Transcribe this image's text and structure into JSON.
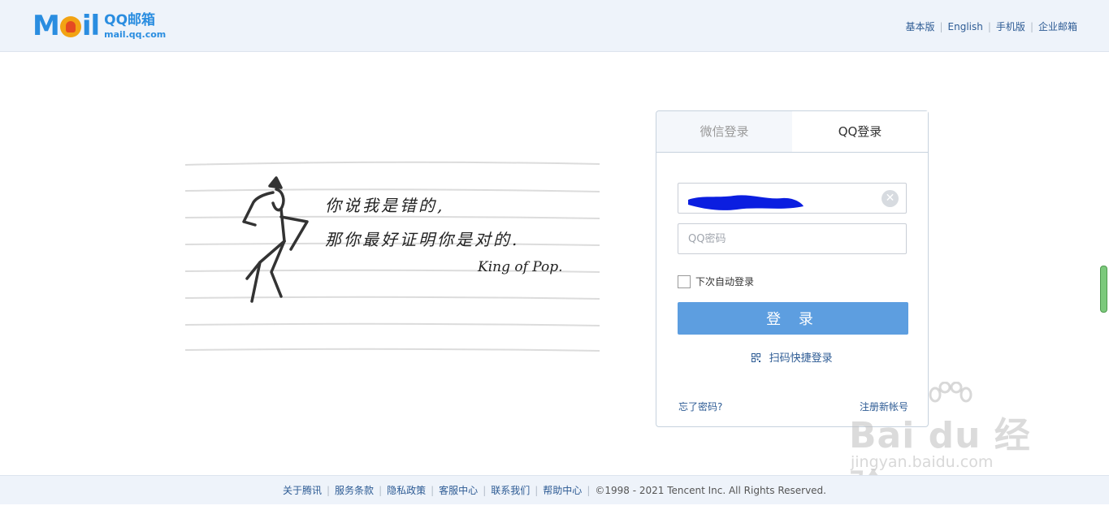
{
  "header": {
    "logo_word_m": "M",
    "logo_word_il": "il",
    "logo_cn": "QQ邮箱",
    "logo_domain": "mail.qq.com",
    "links": [
      "基本版",
      "English",
      "手机版",
      "企业邮箱"
    ]
  },
  "illustration": {
    "line1": "你说我是错的,",
    "line2": "那你最好证明你是对的.",
    "line3": "King of Pop."
  },
  "login": {
    "tab_wechat": "微信登录",
    "tab_qq": "QQ登录",
    "username_value": "",
    "password_placeholder": "QQ密码",
    "clear_icon": "clear-icon",
    "remember_label": "下次自动登录",
    "login_button": "登 录",
    "qr_login": "扫码快捷登录",
    "forgot_password": "忘了密码?",
    "register": "注册新帐号"
  },
  "watermark": {
    "main": "Bai du 经验",
    "sub": "jingyan.baidu.com"
  },
  "footer": {
    "links": [
      "关于腾讯",
      "服务条款",
      "隐私政策",
      "客服中心",
      "联系我们",
      "帮助中心"
    ],
    "copyright": "©1998 - 2021 Tencent Inc. All Rights Reserved."
  },
  "colors": {
    "accent": "#5d9ee0",
    "link": "#2d5b94",
    "header_bg": "#eef3fa",
    "logo_blue": "#2a8de0"
  }
}
